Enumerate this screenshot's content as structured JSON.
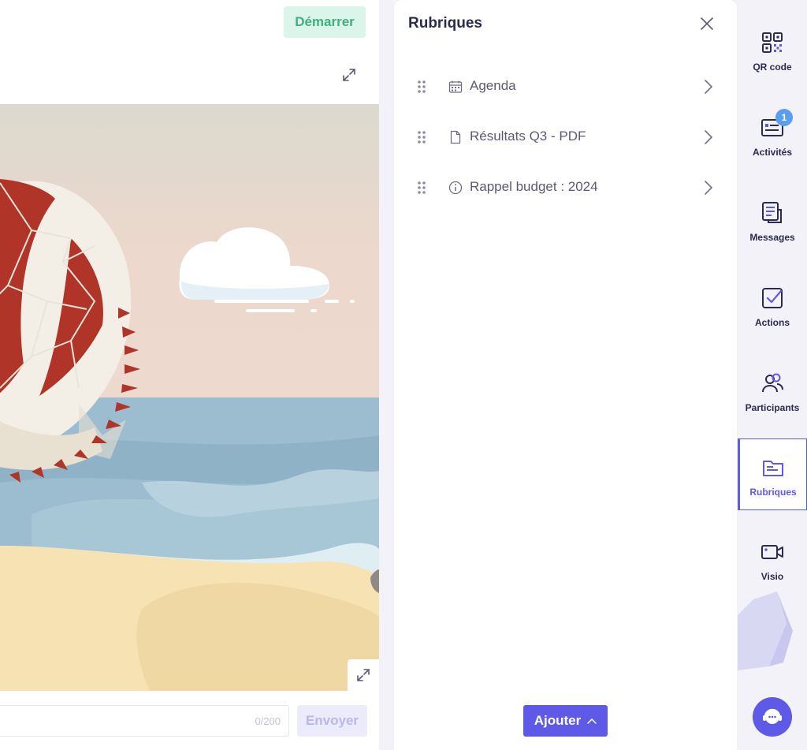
{
  "stage": {
    "start_label": "Démarrer",
    "chat_counter": "0/200",
    "send_label": "Envoyer"
  },
  "rubriques": {
    "title": "Rubriques",
    "items": [
      {
        "label": "Agenda",
        "icon": "calendar-icon"
      },
      {
        "label": "Résultats Q3 - PDF",
        "icon": "document-icon"
      },
      {
        "label": "Rappel budget : 2024",
        "icon": "info-icon"
      }
    ],
    "add_label": "Ajouter"
  },
  "sidebar": {
    "items": [
      {
        "label": "QR code",
        "icon": "qr-code-icon"
      },
      {
        "label": "Activités",
        "icon": "activities-icon",
        "badge": "1"
      },
      {
        "label": "Messages",
        "icon": "messages-icon"
      },
      {
        "label": "Actions",
        "icon": "actions-check-icon"
      },
      {
        "label": "Participants",
        "icon": "participants-icon"
      },
      {
        "label": "Rubriques",
        "icon": "folder-icon",
        "active": true
      },
      {
        "label": "Visio",
        "icon": "video-icon"
      }
    ]
  },
  "colors": {
    "accent": "#5e59e6",
    "start_bg": "#dcf5ea",
    "start_text": "#3fae80",
    "badge": "#5a9ef0"
  }
}
